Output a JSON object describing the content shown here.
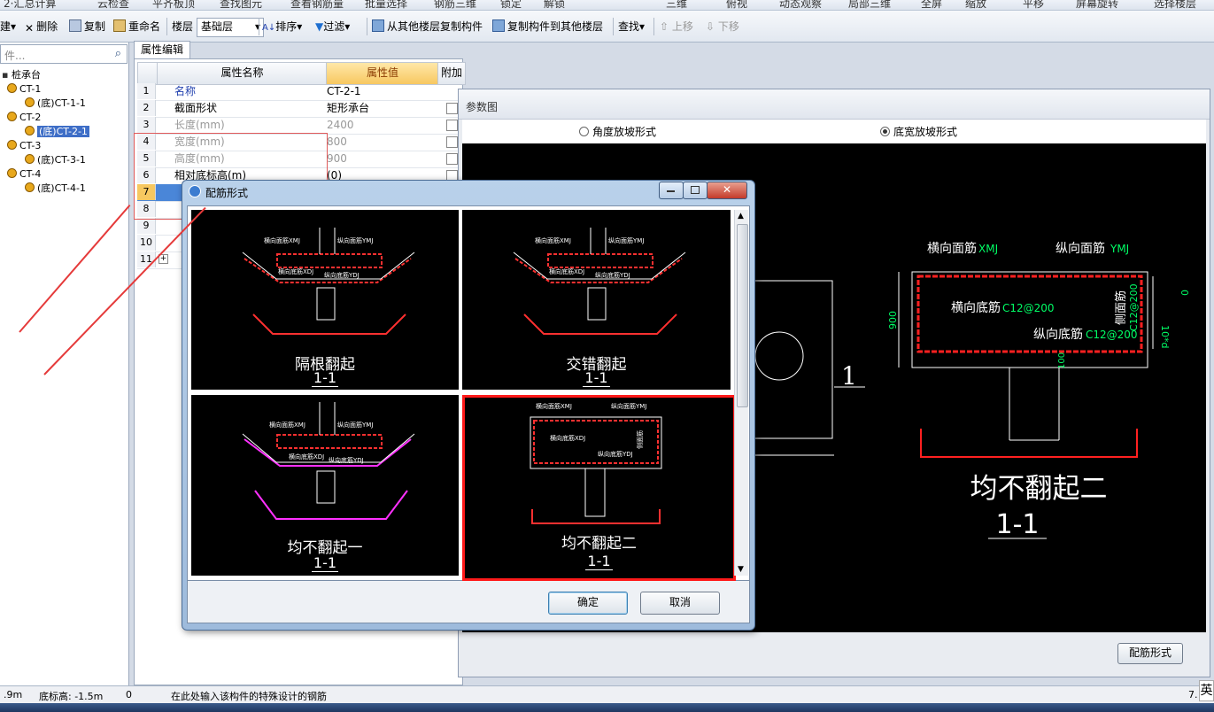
{
  "menu_strip": [
    "2·汇总计算",
    "云检查",
    "平齐板顶",
    "查找图元",
    "查看钢筋量",
    "批量选择",
    "钢筋三维",
    "锁定",
    "解锁",
    "三维",
    "俯视",
    "动态观察",
    "局部三维",
    "全屏",
    "缩放",
    "平移",
    "屏幕旋转",
    "选择楼层"
  ],
  "toolbar": {
    "new_label": "建",
    "delete_label": "删除",
    "copy_label": "复制",
    "rename_label": "重命名",
    "floor_label": "楼层",
    "floor_value": "基础层",
    "sort_label": "排序",
    "filter_label": "过滤",
    "copy_from_label": "从其他楼层复制构件",
    "copy_to_label": "复制构件到其他楼层",
    "find_label": "查找",
    "up_label": "上移",
    "down_label": "下移"
  },
  "search": {
    "placeholder": "件..."
  },
  "tree": {
    "root": "桩承台",
    "items": [
      {
        "label": "CT-1",
        "child": "(底)CT-1-1",
        "selected": false
      },
      {
        "label": "CT-2",
        "child": "(底)CT-2-1",
        "selected": true
      },
      {
        "label": "CT-3",
        "child": "(底)CT-3-1",
        "selected": false
      },
      {
        "label": "CT-4",
        "child": "(底)CT-4-1",
        "selected": false
      }
    ]
  },
  "property_panel": {
    "tab": "属性编辑",
    "headers": [
      "属性名称",
      "属性值",
      "附加"
    ],
    "rows": [
      {
        "num": "1",
        "name": "名称",
        "value": "CT-2-1"
      },
      {
        "num": "2",
        "name": "截面形状",
        "value": "矩形承台"
      },
      {
        "num": "3",
        "name": "长度(mm)",
        "value": "2400"
      },
      {
        "num": "4",
        "name": "宽度(mm)",
        "value": "800"
      },
      {
        "num": "5",
        "name": "高度(mm)",
        "value": "900"
      },
      {
        "num": "6",
        "name": "相对底标高(m)",
        "value": "(0)"
      },
      {
        "num": "7",
        "name": "",
        "value": ""
      },
      {
        "num": "8",
        "name": "",
        "value": ""
      },
      {
        "num": "9",
        "name": "",
        "value": ""
      },
      {
        "num": "10",
        "name": "",
        "value": ""
      },
      {
        "num": "11",
        "name": "",
        "value": ""
      }
    ]
  },
  "param_window": {
    "title": "参数图",
    "radio1": "角度放坡形式",
    "radio2": "底宽放坡形式",
    "button": "配筋形式",
    "drawing": {
      "top_label1": "横向面筋",
      "top_label1_code": "XMJ",
      "top_label2": "纵向面筋",
      "top_label2_code": "YMJ",
      "bottom_label1": "横向底筋",
      "bottom_label1_code": "C12@200",
      "bottom_label2": "纵向底筋",
      "bottom_label2_code": "C12@200",
      "side_label": "侧面筋",
      "side_code": "C12@200",
      "dim_height": "900",
      "dim_top": "0",
      "dim_bottom": "10*d",
      "dim_cover": "100",
      "left_mark": "1",
      "title": "均不翻起二",
      "section": "1-1"
    }
  },
  "dialog": {
    "title": "配筋形式",
    "options": [
      {
        "title": "隔根翻起",
        "section": "1-1",
        "selected": false
      },
      {
        "title": "交错翻起",
        "section": "1-1",
        "selected": false
      },
      {
        "title": "均不翻起一",
        "section": "1-1",
        "selected": false
      },
      {
        "title": "均不翻起二",
        "section": "1-1",
        "selected": true
      }
    ],
    "ok": "确定",
    "cancel": "取消",
    "cad_labels": {
      "xmj": "横向面筋XMJ",
      "ymj": "纵向面筋YMJ",
      "xdj": "横向底筋XDJ",
      "ydj": "纵向底筋YDJ",
      "cmj": "侧面筋"
    }
  },
  "status": {
    "left": ".9m",
    "elev": "底标高: -1.5m",
    "zero": "0",
    "hint": "在此处输入该构件的特殊设计的钢筋",
    "ime": "英",
    "right": "7."
  },
  "colors": {
    "accent": "#e53a3a",
    "rebar": "#ff2020",
    "cad_green": "#00ff66",
    "cad_yellow": "#ffff00",
    "selection": "#3e6ec7"
  }
}
